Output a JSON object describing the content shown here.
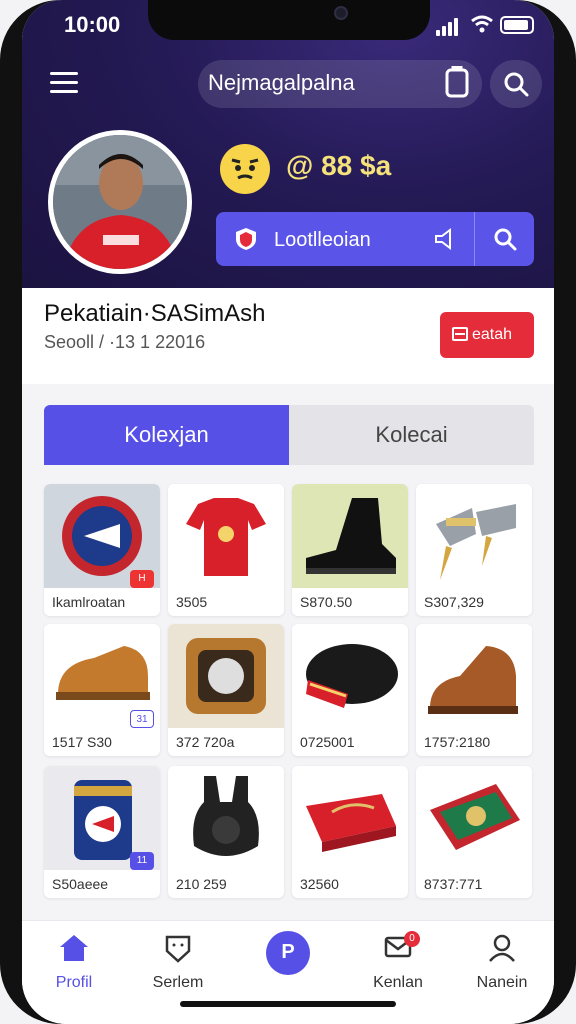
{
  "status": {
    "time": "10:00"
  },
  "header": {
    "title": "Nejmagalpalna"
  },
  "profile": {
    "stats_text": "@ 88 $a",
    "follow_label": "Lootlleoian",
    "name": "Pekatiain·SASimAsh",
    "subtext": "Seooll / ·13 1 22016",
    "action_label": "eatah"
  },
  "tabs": [
    {
      "label": "Kolexjan",
      "active": true
    },
    {
      "label": "Kolecai",
      "active": false
    }
  ],
  "items": [
    {
      "label": "Ikamlroatan",
      "badge": "H"
    },
    {
      "label": "3505"
    },
    {
      "label": "S870.50"
    },
    {
      "label": "S307,329"
    },
    {
      "label": "1517 S30",
      "badge": "31"
    },
    {
      "label": "372 720a"
    },
    {
      "label": "0725001"
    },
    {
      "label": "1757:2180"
    },
    {
      "label": "S50aeee",
      "badge": "11"
    },
    {
      "label": "210 259"
    },
    {
      "label": "32560"
    },
    {
      "label": "8737:771"
    }
  ],
  "nav": [
    {
      "label": "Profil",
      "active": true
    },
    {
      "label": "Serlem"
    },
    {
      "label": "P"
    },
    {
      "label": "Kenlan",
      "badge": "0"
    },
    {
      "label": "Nanein"
    }
  ],
  "colors": {
    "accent": "#5650e6",
    "hero": "#241a55",
    "danger": "#e52c3a"
  }
}
